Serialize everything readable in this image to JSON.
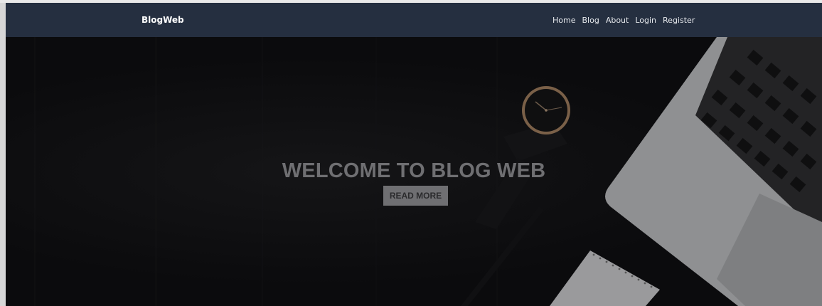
{
  "navbar": {
    "brand": "BlogWeb",
    "links": [
      "Home",
      "Blog",
      "About",
      "Login",
      "Register"
    ]
  },
  "hero": {
    "title": "WELCOME TO BLOG WEB",
    "button_label": "READ MORE"
  },
  "colors": {
    "navbar_bg": "#252f40",
    "hero_bg": "#0b0b0d",
    "hero_text": "#6f6f72"
  },
  "icons": [
    "wristwatch-image",
    "laptop-image",
    "pen-image",
    "notebook-image"
  ]
}
